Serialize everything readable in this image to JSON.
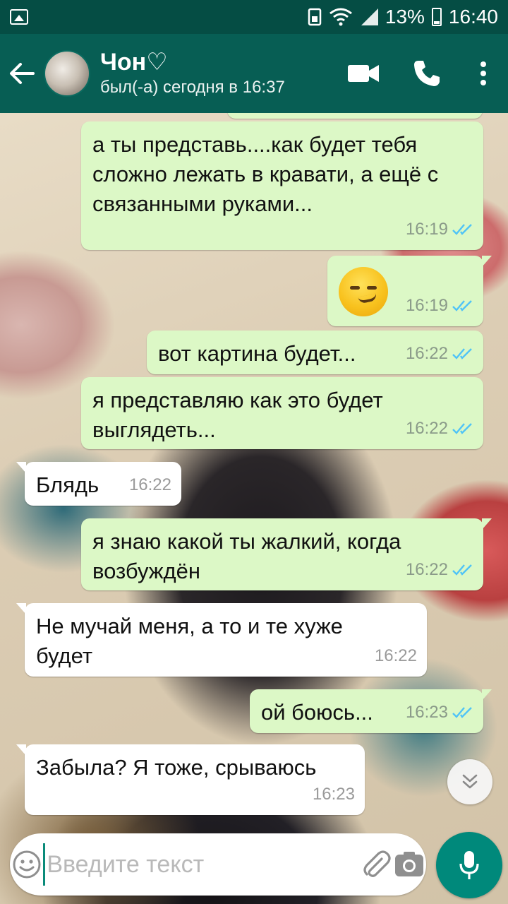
{
  "status_bar": {
    "battery_percent": "13%",
    "time": "16:40"
  },
  "header": {
    "contact_name": "Чон♡",
    "last_seen": "был(-а) сегодня в 16:37"
  },
  "messages": [
    {
      "direction": "out",
      "text": "а ты представь....как будет тебя сложно лежать в кравати, а ещё с связанными руками...",
      "time": "16:19",
      "status": "read"
    },
    {
      "direction": "out",
      "text": "",
      "emoji": "smirking-face",
      "time": "16:19",
      "status": "read"
    },
    {
      "direction": "out",
      "text": "вот картина будет...",
      "time": "16:22",
      "status": "read"
    },
    {
      "direction": "out",
      "text": "я представляю как это будет выглядеть...",
      "time": "16:22",
      "status": "read"
    },
    {
      "direction": "in",
      "text": "Блядь",
      "time": "16:22"
    },
    {
      "direction": "out",
      "text": "я знаю какой ты жалкий, когда возбуждён",
      "time": "16:22",
      "status": "read"
    },
    {
      "direction": "in",
      "text": "Не мучай меня, а то и те хуже будет",
      "time": "16:22"
    },
    {
      "direction": "out",
      "text": "ой боюсь...",
      "time": "16:23",
      "status": "read"
    },
    {
      "direction": "in",
      "text": "Забыла? Я тоже, срываюсь",
      "time": "16:23"
    }
  ],
  "composer": {
    "placeholder": "Введите текст"
  },
  "colors": {
    "header": "#075e54",
    "status_bar": "#054d44",
    "outgoing_bubble": "#dcf8c6",
    "incoming_bubble": "#ffffff",
    "read_ticks": "#4fc3f7",
    "mic_button": "#00897b"
  }
}
